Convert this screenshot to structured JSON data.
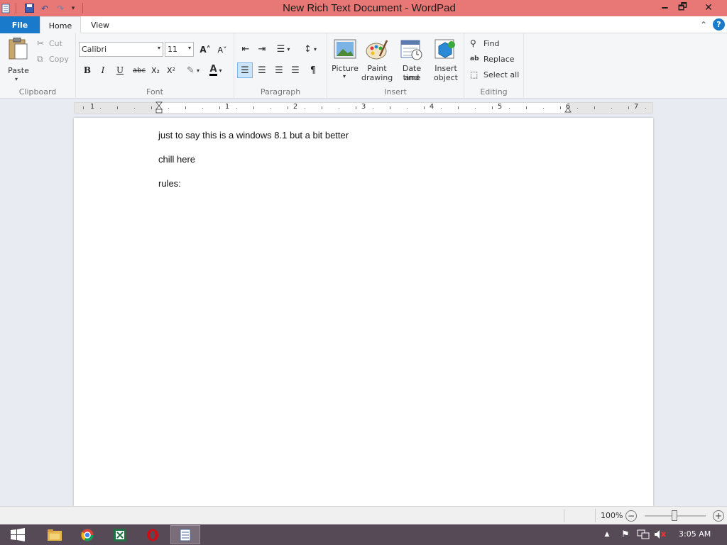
{
  "window": {
    "title": "New Rich Text Document - WordPad",
    "qat_icons": [
      "wordpad-app-icon",
      "save-icon",
      "undo-icon",
      "redo-icon",
      "customize-quick-access-icon"
    ],
    "controls": {
      "minimize": "🗕",
      "restore": "🗗",
      "close": "✕"
    }
  },
  "tabs": {
    "file": "File",
    "home": "Home",
    "view": "View"
  },
  "clipboard": {
    "paste": "Paste",
    "cut": "Cut",
    "copy": "Copy",
    "group": "Clipboard"
  },
  "font": {
    "family": "Calibri",
    "size": "11",
    "group": "Font",
    "bold": "B",
    "italic": "I",
    "underline": "U",
    "strike": "abc",
    "sub": "X₂",
    "sup": "X²",
    "grow": "A˄",
    "shrink": "A˅",
    "color_letter": "A"
  },
  "paragraph": {
    "group": "Paragraph"
  },
  "insert": {
    "picture": "Picture",
    "paint_1": "Paint",
    "paint_2": "drawing",
    "date_1": "Date and",
    "date_2": "time",
    "object_1": "Insert",
    "object_2": "object",
    "group": "Insert"
  },
  "editing": {
    "find": "Find",
    "replace": "Replace",
    "select_all": "Select all",
    "group": "Editing"
  },
  "ruler": {
    "labels": [
      "1",
      "1",
      "2",
      "3",
      "4",
      "5",
      "6",
      "7"
    ]
  },
  "document": {
    "lines": [
      "just to say this is a windows 8.1 but a bit better",
      "chill here",
      "rules:"
    ]
  },
  "status": {
    "zoom": "100%",
    "minus": "−",
    "plus": "+"
  },
  "taskbar": {
    "time": "3:05 AM",
    "apps": [
      "file-explorer-icon",
      "chrome-icon",
      "excel-icon",
      "opera-icon",
      "wordpad-icon"
    ]
  },
  "colors": {
    "titlebar": "#e77876",
    "file_tab": "#1979ca",
    "taskbar": "#574a57",
    "highlight_button": "#cce4f7"
  }
}
